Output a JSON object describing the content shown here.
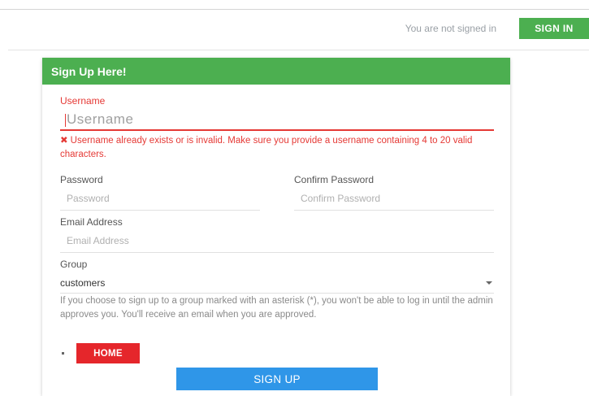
{
  "topbar": {
    "status_text": "You are not signed in",
    "signin_label": "SIGN IN"
  },
  "card": {
    "title": "Sign Up Here!",
    "username": {
      "label": "Username",
      "placeholder": "Username",
      "error_icon": "✖",
      "error": "Username already exists or is invalid. Make sure you provide a username containing 4 to 20 valid characters."
    },
    "password": {
      "label": "Password",
      "placeholder": "Password"
    },
    "confirm_password": {
      "label": "Confirm Password",
      "placeholder": "Confirm Password"
    },
    "email": {
      "label": "Email Address",
      "placeholder": "Email Address"
    },
    "group": {
      "label": "Group",
      "selected": "customers",
      "help": "If you choose to sign up to a group marked with an asterisk (*), you won't be able to log in until the admin approves you. You'll receive an email when you are approved."
    },
    "home_label": "HOME",
    "signup_label": "SIGN UP"
  },
  "colors": {
    "header_green": "#4caf50",
    "error_red": "#e53935",
    "home_red": "#e5262b",
    "signup_blue": "#2f96e8"
  }
}
